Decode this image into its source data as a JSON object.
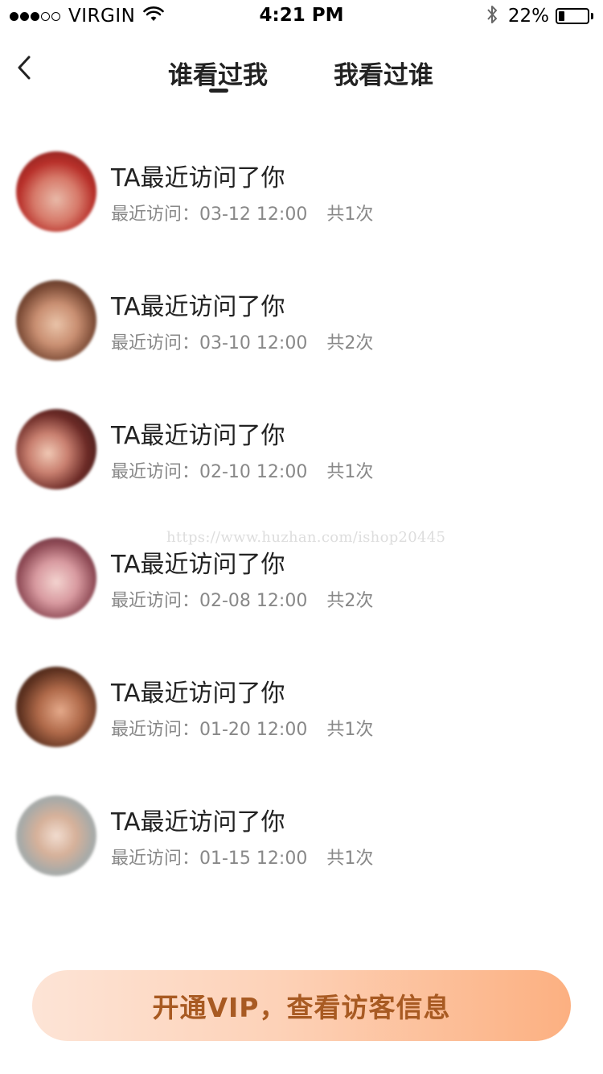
{
  "status_bar": {
    "carrier": "VIRGIN",
    "signal_strength": 3,
    "time": "4:21 PM",
    "battery_percent": "22%",
    "battery_level": 0.22,
    "icons": [
      "signal-dots-icon",
      "wifi-icon",
      "bluetooth-icon",
      "battery-icon"
    ]
  },
  "nav": {
    "back_icon": "chevron-left-icon",
    "tabs": [
      {
        "label": "谁看过我",
        "active": true
      },
      {
        "label": "我看过谁",
        "active": false
      }
    ]
  },
  "visitors": [
    {
      "title": "TA最近访问了你",
      "visit_label": "最近访问：03-12 12:00",
      "count": "共1次"
    },
    {
      "title": "TA最近访问了你",
      "visit_label": "最近访问：03-10 12:00",
      "count": "共2次"
    },
    {
      "title": "TA最近访问了你",
      "visit_label": "最近访问：02-10 12:00",
      "count": "共1次"
    },
    {
      "title": "TA最近访问了你",
      "visit_label": "最近访问：02-08 12:00",
      "count": "共2次"
    },
    {
      "title": "TA最近访问了你",
      "visit_label": "最近访问：01-20 12:00",
      "count": "共1次"
    },
    {
      "title": "TA最近访问了你",
      "visit_label": "最近访问：01-15 12:00",
      "count": "共1次"
    }
  ],
  "watermark": "https://www.huzhan.com/ishop20445",
  "cta": {
    "label": "开通VIP，查看访客信息"
  },
  "colors": {
    "cta_text": "#a85a22",
    "cta_gradient_start": "#fde4d6",
    "cta_gradient_end": "#fcb081",
    "meta_text": "#888888"
  }
}
